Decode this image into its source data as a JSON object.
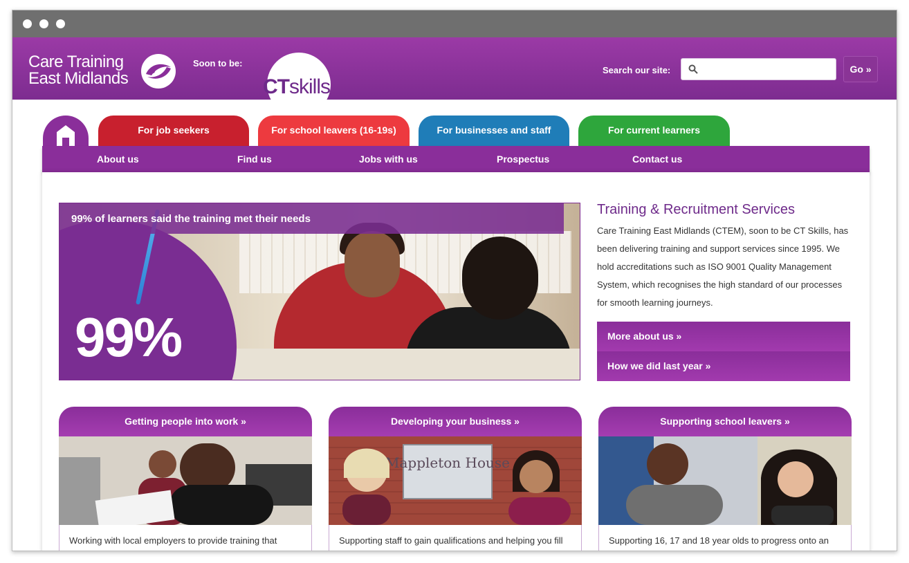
{
  "header": {
    "logo_line1": "Care Training",
    "logo_line2": "East Midlands",
    "soon_label": "Soon to be:",
    "ct_logo_bold": "CT",
    "ct_logo_thin": "skills",
    "search_label": "Search our site:",
    "search_value": "",
    "search_placeholder": "",
    "go_label": "Go »"
  },
  "tabs": [
    {
      "label": "For job seekers",
      "color": "#c8202e"
    },
    {
      "label": "For school leavers (16-19s)",
      "color": "#ed3a3f"
    },
    {
      "label": "For businesses and staff",
      "color": "#1f7db8"
    },
    {
      "label": "For current learners",
      "color": "#2ea63c"
    }
  ],
  "nav": {
    "items": [
      "About us",
      "Find us",
      "Jobs with us",
      "Prospectus",
      "Contact us"
    ]
  },
  "hero": {
    "banner": "99% of learners said the training met their needs",
    "big_number": "99%"
  },
  "intro": {
    "title": "Training & Recruitment Services",
    "text": "Care Training East Midlands (CTEM), soon to be CT Skills, has been delivering training and support services since 1995. We hold accreditations such as ISO 9001 Quality Management System, which recognises the high standard of our processes for smooth learning journeys.",
    "link1": "More about us »",
    "link2": "How we did last year »"
  },
  "cards": [
    {
      "title": "Getting people into work »",
      "text": "Working with local employers to provide training that"
    },
    {
      "title": "Developing your business »",
      "text": "Supporting staff to gain qualifications and helping you fill",
      "sign": "Mappleton House"
    },
    {
      "title": "Supporting school leavers »",
      "text": "Supporting 16, 17 and 18 year olds to progress onto an"
    }
  ],
  "colors": {
    "brand_purple": "#8a2e9a",
    "header_purple": "#9b3aa6"
  }
}
